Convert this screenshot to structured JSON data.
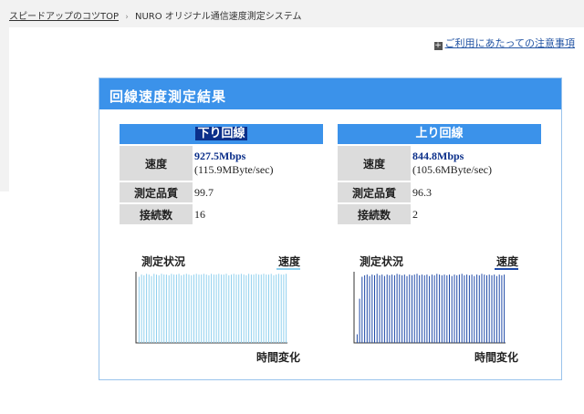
{
  "breadcrumb": {
    "home_link": "スピードアップのコツTOP",
    "separator": "›",
    "current": "NURO オリジナル通信速度測定システム"
  },
  "notice": {
    "icon": "square-bullet-icon",
    "link": "ご利用にあたっての注意事項"
  },
  "panel": {
    "title": "回線速度測定結果"
  },
  "download": {
    "heading": "下り回線",
    "speed_label": "速度",
    "speed_mbps": "927.5Mbps",
    "speed_mbyte": "(115.9MByte/sec)",
    "quality_label": "測定品質",
    "quality_value": "99.7",
    "connections_label": "接続数",
    "connections_value": "16",
    "graph": {
      "title": "測定状況",
      "legend": "速度",
      "x_label": "時間変化",
      "color": "#8fd0ee",
      "profile": [
        0.93,
        0.96,
        0.95,
        0.97,
        0.96,
        0.94,
        0.97,
        0.96,
        0.95,
        0.97,
        0.96,
        0.96,
        0.95,
        0.97,
        0.96,
        0.96,
        0.97,
        0.95,
        0.96,
        0.97,
        0.96,
        0.95,
        0.96,
        0.97,
        0.96,
        0.96,
        0.97,
        0.96,
        0.95,
        0.97,
        0.96,
        0.96,
        0.97,
        0.96,
        0.96,
        0.97,
        0.95,
        0.96,
        0.97,
        0.96,
        0.96,
        0.97,
        0.96,
        0.95,
        0.97,
        0.96,
        0.96,
        0.97,
        0.96,
        0.96,
        0.97,
        0.96,
        0.96,
        0.97,
        0.95,
        0.96,
        0.97,
        0.96,
        0.96,
        0.97
      ]
    }
  },
  "upload": {
    "heading": "上り回線",
    "speed_label": "速度",
    "speed_mbps": "844.8Mbps",
    "speed_mbyte": "(105.6MByte/sec)",
    "quality_label": "測定品質",
    "quality_value": "96.3",
    "connections_label": "接続数",
    "connections_value": "2",
    "graph": {
      "title": "測定状況",
      "legend": "速度",
      "x_label": "時間変化",
      "color": "#1f4aa8",
      "profile": [
        0.12,
        0.62,
        0.93,
        0.95,
        0.96,
        0.94,
        0.96,
        0.95,
        0.97,
        0.95,
        0.96,
        0.94,
        0.96,
        0.95,
        0.96,
        0.95,
        0.97,
        0.96,
        0.95,
        0.96,
        0.94,
        0.96,
        0.95,
        0.96,
        0.97,
        0.95,
        0.96,
        0.95,
        0.96,
        0.94,
        0.96,
        0.95,
        0.97,
        0.96,
        0.95,
        0.96,
        0.95,
        0.96,
        0.94,
        0.96,
        0.95,
        0.96,
        0.97,
        0.95,
        0.96,
        0.95,
        0.96,
        0.94,
        0.96,
        0.95,
        0.97,
        0.96,
        0.95,
        0.96,
        0.95,
        0.96,
        0.94,
        0.96,
        0.95,
        0.96
      ]
    }
  }
}
